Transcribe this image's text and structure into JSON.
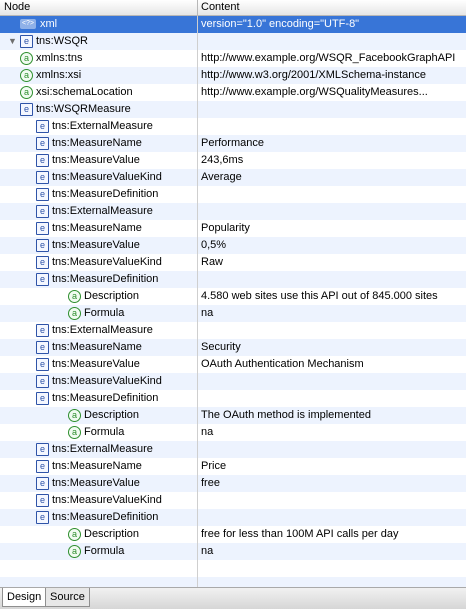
{
  "header": {
    "node_label": "Node",
    "content_label": "Content"
  },
  "tree": [
    {
      "name": "xml",
      "content": "version=\"1.0\" encoding=\"UTF-8\"",
      "type": "pi",
      "level": 0,
      "toggle": "none",
      "selected": true
    },
    {
      "name": "tns:WSQR",
      "content": "",
      "type": "element",
      "level": 0,
      "toggle": "expanded"
    },
    {
      "name": "xmlns:tns",
      "content": "http://www.example.org/WSQR_FacebookGraphAPI",
      "type": "attribute",
      "level": 1,
      "toggle": "none"
    },
    {
      "name": "xmlns:xsi",
      "content": "http://www.w3.org/2001/XMLSchema-instance",
      "type": "attribute",
      "level": 1,
      "toggle": "none"
    },
    {
      "name": "xsi:schemaLocation",
      "content": "http://www.example.org/WSQualityMeasures...",
      "type": "attribute",
      "level": 1,
      "toggle": "none"
    },
    {
      "name": "tns:WSQRMeasure",
      "content": "",
      "type": "element",
      "level": 1,
      "toggle": "expanded"
    },
    {
      "name": "tns:ExternalMeasure",
      "content": "",
      "type": "element",
      "level": 2,
      "toggle": "collapsed"
    },
    {
      "name": "tns:MeasureName",
      "content": "Performance",
      "type": "element",
      "level": 2,
      "toggle": "none"
    },
    {
      "name": "tns:MeasureValue",
      "content": "243,6ms",
      "type": "element",
      "level": 2,
      "toggle": "none"
    },
    {
      "name": "tns:MeasureValueKind",
      "content": "Average",
      "type": "element",
      "level": 2,
      "toggle": "none"
    },
    {
      "name": "tns:MeasureDefinition",
      "content": "",
      "type": "element",
      "level": 2,
      "toggle": "collapsed"
    },
    {
      "name": "tns:ExternalMeasure",
      "content": "",
      "type": "element",
      "level": 2,
      "toggle": "collapsed"
    },
    {
      "name": "tns:MeasureName",
      "content": "Popularity",
      "type": "element",
      "level": 2,
      "toggle": "none"
    },
    {
      "name": "tns:MeasureValue",
      "content": "0,5%",
      "type": "element",
      "level": 2,
      "toggle": "none"
    },
    {
      "name": "tns:MeasureValueKind",
      "content": "Raw",
      "type": "element",
      "level": 2,
      "toggle": "none"
    },
    {
      "name": "tns:MeasureDefinition",
      "content": "",
      "type": "element",
      "level": 2,
      "toggle": "expanded"
    },
    {
      "name": "Description",
      "content": "4.580 web sites use this API out of 845.000 sites",
      "type": "attribute",
      "level": 3,
      "toggle": "none"
    },
    {
      "name": "Formula",
      "content": "na",
      "type": "attribute",
      "level": 3,
      "toggle": "none"
    },
    {
      "name": "tns:ExternalMeasure",
      "content": "",
      "type": "element",
      "level": 2,
      "toggle": "collapsed"
    },
    {
      "name": "tns:MeasureName",
      "content": "Security",
      "type": "element",
      "level": 2,
      "toggle": "none"
    },
    {
      "name": "tns:MeasureValue",
      "content": "OAuth Authentication Mechanism",
      "type": "element",
      "level": 2,
      "toggle": "none"
    },
    {
      "name": "tns:MeasureValueKind",
      "content": "",
      "type": "element",
      "level": 2,
      "toggle": "none"
    },
    {
      "name": "tns:MeasureDefinition",
      "content": "",
      "type": "element",
      "level": 2,
      "toggle": "expanded"
    },
    {
      "name": "Description",
      "content": "The OAuth method is implemented",
      "type": "attribute",
      "level": 3,
      "toggle": "none"
    },
    {
      "name": "Formula",
      "content": "na",
      "type": "attribute",
      "level": 3,
      "toggle": "none"
    },
    {
      "name": "tns:ExternalMeasure",
      "content": "",
      "type": "element",
      "level": 2,
      "toggle": "collapsed"
    },
    {
      "name": "tns:MeasureName",
      "content": "Price",
      "type": "element",
      "level": 2,
      "toggle": "none"
    },
    {
      "name": "tns:MeasureValue",
      "content": "free",
      "type": "element",
      "level": 2,
      "toggle": "none"
    },
    {
      "name": "tns:MeasureValueKind",
      "content": "",
      "type": "element",
      "level": 2,
      "toggle": "none"
    },
    {
      "name": "tns:MeasureDefinition",
      "content": "",
      "type": "element",
      "level": 2,
      "toggle": "expanded"
    },
    {
      "name": "Description",
      "content": "free for less than 100M API calls per day",
      "type": "attribute",
      "level": 3,
      "toggle": "none"
    },
    {
      "name": "Formula",
      "content": "na",
      "type": "attribute",
      "level": 3,
      "toggle": "none"
    }
  ],
  "icons": {
    "element": {
      "name": "element-icon",
      "glyph": "e"
    },
    "attribute": {
      "name": "attribute-icon",
      "glyph": "a"
    },
    "pi": {
      "name": "processing-instruction-icon",
      "glyph": "<?>"
    }
  },
  "toggles": {
    "expanded": {
      "name": "triangle-expanded-icon",
      "glyph": "▼"
    },
    "collapsed": {
      "name": "triangle-collapsed-icon",
      "glyph": "▶"
    }
  },
  "tabs": [
    {
      "label": "Design",
      "active": true
    },
    {
      "label": "Source",
      "active": false
    }
  ],
  "colors": {
    "selection": "#3875d7",
    "alt_row": "#edf3fe",
    "element_icon": "#2f54a8",
    "attribute_icon": "#2f8f2f"
  }
}
